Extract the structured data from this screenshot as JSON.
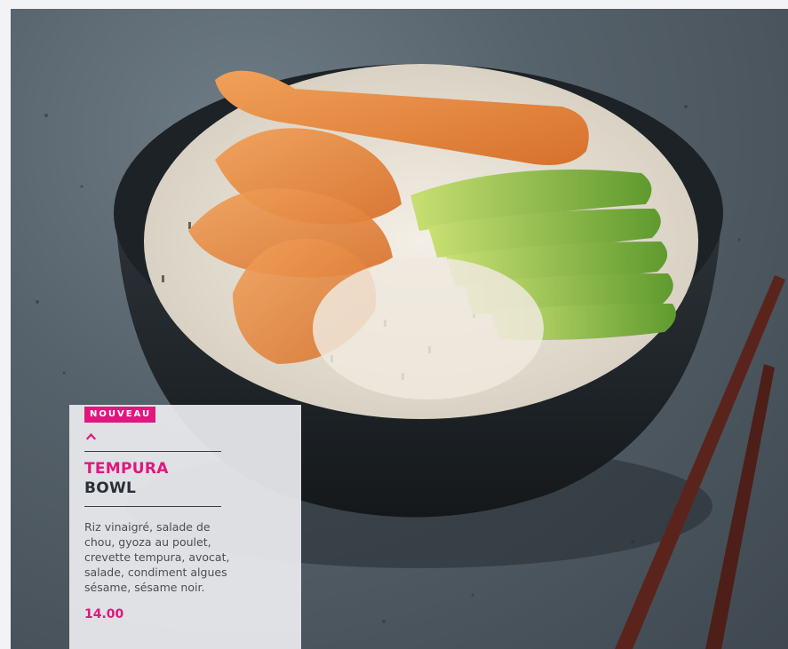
{
  "product": {
    "badge": "NOUVEAU",
    "title_line1": "TEMPURA",
    "title_line2": "BOWL",
    "description_lines": [
      "Riz vinaigré, salade de",
      "chou, gyoza au poulet,",
      "crevette tempura, avocat,",
      "salade, condiment algues",
      "sésame, sésame noir."
    ],
    "price": "14.00"
  },
  "photo": {
    "icon": "tempura-bowl-photo"
  },
  "colors": {
    "accent": "#e0177f",
    "title_dark": "#2a3038",
    "text": "#4a4f55",
    "card_bg": "#ebedf0"
  }
}
